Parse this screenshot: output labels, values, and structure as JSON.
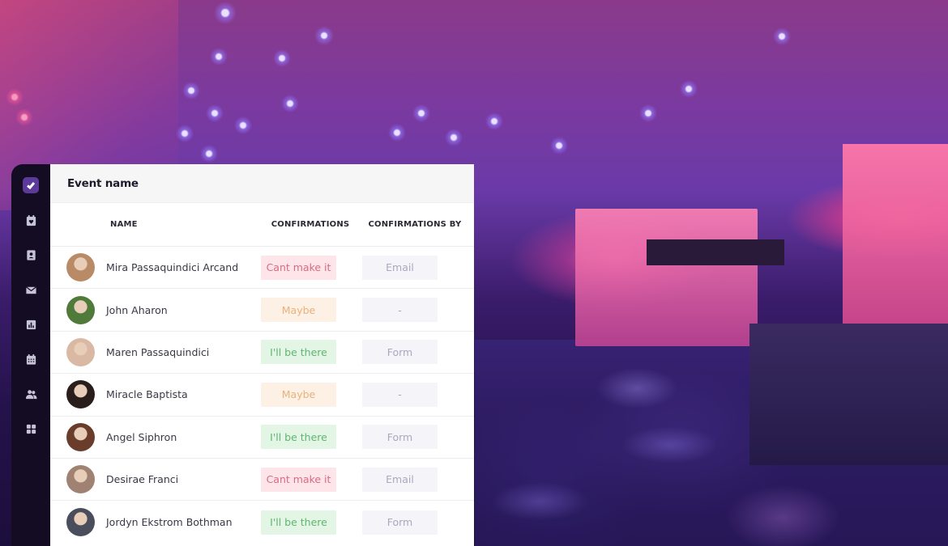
{
  "sidebar": {
    "items": [
      {
        "icon": "check-icon",
        "active": true
      },
      {
        "icon": "calendar-heart-icon",
        "active": false
      },
      {
        "icon": "contacts-book-icon",
        "active": false
      },
      {
        "icon": "envelope-icon",
        "active": false
      },
      {
        "icon": "bar-chart-icon",
        "active": false
      },
      {
        "icon": "calendar-grid-icon",
        "active": false
      },
      {
        "icon": "users-icon",
        "active": false
      },
      {
        "icon": "apps-grid-icon",
        "active": false
      }
    ]
  },
  "panel": {
    "title": "Event name",
    "columns": {
      "name": "NAME",
      "confirmations": "CONFIRMATIONS",
      "confirmations_by": "CONFIRMATIONS BY"
    },
    "rows": [
      {
        "name": "Mira Passaquindici Arcand",
        "confirmation": "Cant make it",
        "status": "cant",
        "by": "Email",
        "avatar_color": "#b98a66"
      },
      {
        "name": "John Aharon",
        "confirmation": "Maybe",
        "status": "maybe",
        "by": "-",
        "avatar_color": "#4f7a3a"
      },
      {
        "name": "Maren Passaquindici",
        "confirmation": "I'll be there",
        "status": "yes",
        "by": "Form",
        "avatar_color": "#d9b8a4"
      },
      {
        "name": "Miracle Baptista",
        "confirmation": "Maybe",
        "status": "maybe",
        "by": "-",
        "avatar_color": "#2a1e1c"
      },
      {
        "name": "Angel Siphron",
        "confirmation": "I'll be there",
        "status": "yes",
        "by": "Form",
        "avatar_color": "#6a3c2c"
      },
      {
        "name": "Desirae Franci",
        "confirmation": "Cant make it",
        "status": "cant",
        "by": "Email",
        "avatar_color": "#a08272"
      },
      {
        "name": "Jordyn Ekstrom Bothman",
        "confirmation": "I'll be there",
        "status": "yes",
        "by": "Form",
        "avatar_color": "#4a4e5c"
      }
    ]
  },
  "colors": {
    "sidebar_bg": "#140c22",
    "accent": "#5b3a9a",
    "cant": "#d86b82",
    "maybe": "#e9b17e",
    "yes": "#5fb56f"
  }
}
